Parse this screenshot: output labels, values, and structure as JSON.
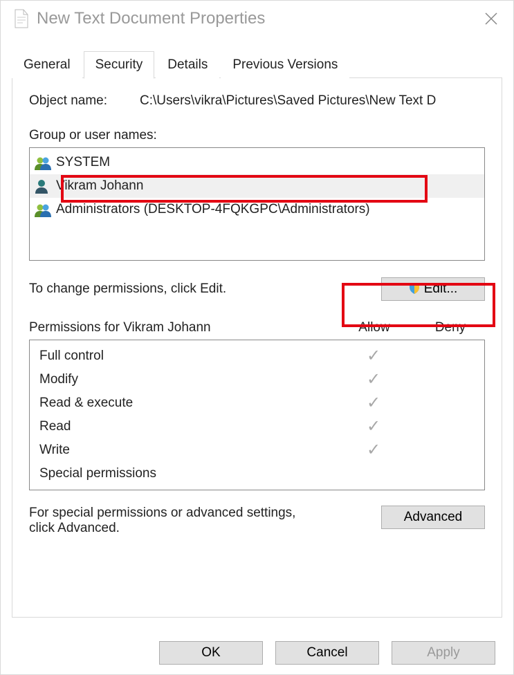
{
  "window": {
    "title": "New Text Document Properties"
  },
  "tabs": [
    "General",
    "Security",
    "Details",
    "Previous Versions"
  ],
  "activeTab": "Security",
  "object": {
    "label": "Object name:",
    "value": "C:\\Users\\vikra\\Pictures\\Saved Pictures\\New Text D"
  },
  "groupLabel": "Group or user names:",
  "users": [
    {
      "name": "SYSTEM",
      "icon": "people"
    },
    {
      "name": "Vikram Johann",
      "icon": "person",
      "selected": true
    },
    {
      "name": "Administrators (DESKTOP-4FQKGPC\\Administrators)",
      "icon": "people"
    }
  ],
  "changeText": "To change permissions, click Edit.",
  "editBtn": "Edit...",
  "permHeader": {
    "name": "Permissions for Vikram Johann",
    "allow": "Allow",
    "deny": "Deny"
  },
  "permissions": [
    {
      "name": "Full control",
      "allow": true,
      "deny": false
    },
    {
      "name": "Modify",
      "allow": true,
      "deny": false
    },
    {
      "name": "Read & execute",
      "allow": true,
      "deny": false
    },
    {
      "name": "Read",
      "allow": true,
      "deny": false
    },
    {
      "name": "Write",
      "allow": true,
      "deny": false
    },
    {
      "name": "Special permissions",
      "allow": false,
      "deny": false
    }
  ],
  "advText": "For special permissions or advanced settings, click Advanced.",
  "advBtn": "Advanced",
  "footer": {
    "ok": "OK",
    "cancel": "Cancel",
    "apply": "Apply"
  }
}
